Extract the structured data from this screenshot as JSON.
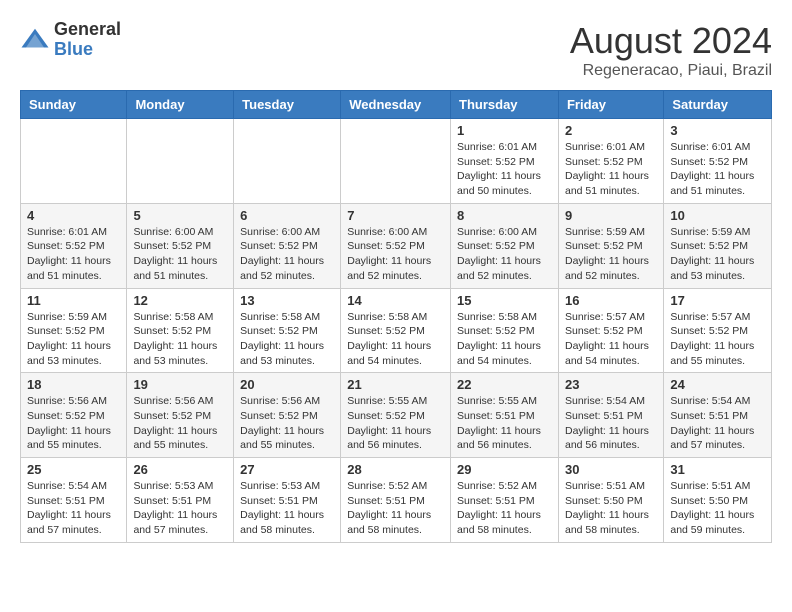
{
  "header": {
    "logo_general": "General",
    "logo_blue": "Blue",
    "month_year": "August 2024",
    "location": "Regeneracao, Piaui, Brazil"
  },
  "days_of_week": [
    "Sunday",
    "Monday",
    "Tuesday",
    "Wednesday",
    "Thursday",
    "Friday",
    "Saturday"
  ],
  "weeks": [
    [
      {
        "day": "",
        "info": ""
      },
      {
        "day": "",
        "info": ""
      },
      {
        "day": "",
        "info": ""
      },
      {
        "day": "",
        "info": ""
      },
      {
        "day": "1",
        "info": "Sunrise: 6:01 AM\nSunset: 5:52 PM\nDaylight: 11 hours and 50 minutes."
      },
      {
        "day": "2",
        "info": "Sunrise: 6:01 AM\nSunset: 5:52 PM\nDaylight: 11 hours and 51 minutes."
      },
      {
        "day": "3",
        "info": "Sunrise: 6:01 AM\nSunset: 5:52 PM\nDaylight: 11 hours and 51 minutes."
      }
    ],
    [
      {
        "day": "4",
        "info": "Sunrise: 6:01 AM\nSunset: 5:52 PM\nDaylight: 11 hours and 51 minutes."
      },
      {
        "day": "5",
        "info": "Sunrise: 6:00 AM\nSunset: 5:52 PM\nDaylight: 11 hours and 51 minutes."
      },
      {
        "day": "6",
        "info": "Sunrise: 6:00 AM\nSunset: 5:52 PM\nDaylight: 11 hours and 52 minutes."
      },
      {
        "day": "7",
        "info": "Sunrise: 6:00 AM\nSunset: 5:52 PM\nDaylight: 11 hours and 52 minutes."
      },
      {
        "day": "8",
        "info": "Sunrise: 6:00 AM\nSunset: 5:52 PM\nDaylight: 11 hours and 52 minutes."
      },
      {
        "day": "9",
        "info": "Sunrise: 5:59 AM\nSunset: 5:52 PM\nDaylight: 11 hours and 52 minutes."
      },
      {
        "day": "10",
        "info": "Sunrise: 5:59 AM\nSunset: 5:52 PM\nDaylight: 11 hours and 53 minutes."
      }
    ],
    [
      {
        "day": "11",
        "info": "Sunrise: 5:59 AM\nSunset: 5:52 PM\nDaylight: 11 hours and 53 minutes."
      },
      {
        "day": "12",
        "info": "Sunrise: 5:58 AM\nSunset: 5:52 PM\nDaylight: 11 hours and 53 minutes."
      },
      {
        "day": "13",
        "info": "Sunrise: 5:58 AM\nSunset: 5:52 PM\nDaylight: 11 hours and 53 minutes."
      },
      {
        "day": "14",
        "info": "Sunrise: 5:58 AM\nSunset: 5:52 PM\nDaylight: 11 hours and 54 minutes."
      },
      {
        "day": "15",
        "info": "Sunrise: 5:58 AM\nSunset: 5:52 PM\nDaylight: 11 hours and 54 minutes."
      },
      {
        "day": "16",
        "info": "Sunrise: 5:57 AM\nSunset: 5:52 PM\nDaylight: 11 hours and 54 minutes."
      },
      {
        "day": "17",
        "info": "Sunrise: 5:57 AM\nSunset: 5:52 PM\nDaylight: 11 hours and 55 minutes."
      }
    ],
    [
      {
        "day": "18",
        "info": "Sunrise: 5:56 AM\nSunset: 5:52 PM\nDaylight: 11 hours and 55 minutes."
      },
      {
        "day": "19",
        "info": "Sunrise: 5:56 AM\nSunset: 5:52 PM\nDaylight: 11 hours and 55 minutes."
      },
      {
        "day": "20",
        "info": "Sunrise: 5:56 AM\nSunset: 5:52 PM\nDaylight: 11 hours and 55 minutes."
      },
      {
        "day": "21",
        "info": "Sunrise: 5:55 AM\nSunset: 5:52 PM\nDaylight: 11 hours and 56 minutes."
      },
      {
        "day": "22",
        "info": "Sunrise: 5:55 AM\nSunset: 5:51 PM\nDaylight: 11 hours and 56 minutes."
      },
      {
        "day": "23",
        "info": "Sunrise: 5:54 AM\nSunset: 5:51 PM\nDaylight: 11 hours and 56 minutes."
      },
      {
        "day": "24",
        "info": "Sunrise: 5:54 AM\nSunset: 5:51 PM\nDaylight: 11 hours and 57 minutes."
      }
    ],
    [
      {
        "day": "25",
        "info": "Sunrise: 5:54 AM\nSunset: 5:51 PM\nDaylight: 11 hours and 57 minutes."
      },
      {
        "day": "26",
        "info": "Sunrise: 5:53 AM\nSunset: 5:51 PM\nDaylight: 11 hours and 57 minutes."
      },
      {
        "day": "27",
        "info": "Sunrise: 5:53 AM\nSunset: 5:51 PM\nDaylight: 11 hours and 58 minutes."
      },
      {
        "day": "28",
        "info": "Sunrise: 5:52 AM\nSunset: 5:51 PM\nDaylight: 11 hours and 58 minutes."
      },
      {
        "day": "29",
        "info": "Sunrise: 5:52 AM\nSunset: 5:51 PM\nDaylight: 11 hours and 58 minutes."
      },
      {
        "day": "30",
        "info": "Sunrise: 5:51 AM\nSunset: 5:50 PM\nDaylight: 11 hours and 58 minutes."
      },
      {
        "day": "31",
        "info": "Sunrise: 5:51 AM\nSunset: 5:50 PM\nDaylight: 11 hours and 59 minutes."
      }
    ]
  ]
}
